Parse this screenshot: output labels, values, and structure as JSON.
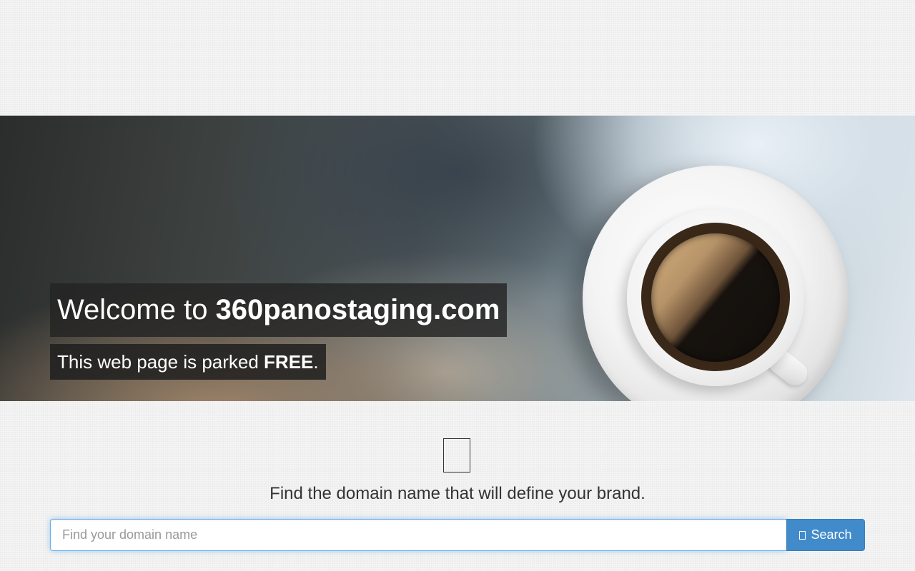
{
  "hero": {
    "welcome_prefix": "Welcome to ",
    "domain": "360panostaging.com",
    "parked_prefix": "This web page is parked ",
    "parked_emphasis": "FREE",
    "parked_suffix": "."
  },
  "search_section": {
    "icon": "lightbulb-icon",
    "tagline": "Find the domain name that will define your brand.",
    "input_value": "",
    "input_placeholder": "Find your domain name",
    "button_icon": "search-icon",
    "button_label": "Search"
  },
  "colors": {
    "page_background": "#f1f1f1",
    "button_primary": "#428bca",
    "input_focus_border": "#66afe9",
    "overlay_dark": "#232323"
  }
}
